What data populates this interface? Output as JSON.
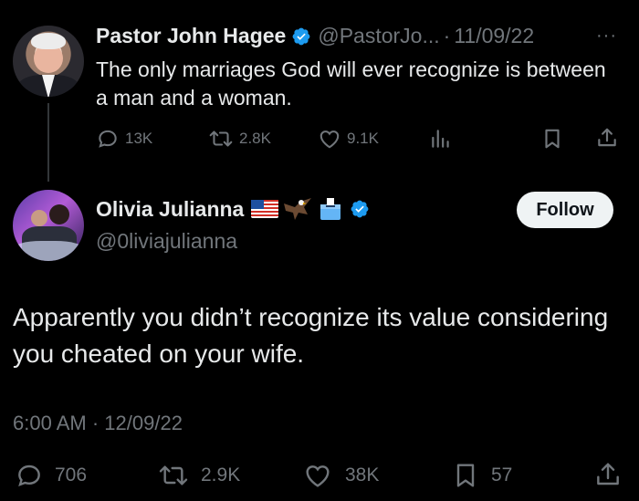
{
  "original_tweet": {
    "author_name": "Pastor John Hagee",
    "handle": "@PastorJo...",
    "separator": "·",
    "date": "11/09/22",
    "more": "···",
    "text": "The only marriages God will ever recognize is between a man and a woman.",
    "actions": {
      "replies": "13K",
      "retweets": "2.8K",
      "likes": "9.1K"
    }
  },
  "reply_tweet": {
    "author_name": "Olivia Julianna",
    "handle": "@0liviajulianna",
    "follow_label": "Follow",
    "text": "Apparently you didn’t recognize its value considering you cheated on your wife.",
    "time": "6:00 AM",
    "separator": "·",
    "date": "12/09/22",
    "actions": {
      "replies": "706",
      "retweets": "2.9K",
      "likes": "38K",
      "bookmarks": "57"
    }
  },
  "colors": {
    "background": "#000000",
    "text": "#e7e9ea",
    "secondary": "#71767b",
    "verified": "#1d9bf0",
    "follow_bg": "#eff3f4"
  },
  "icons": [
    "verified-badge-icon",
    "reply-icon",
    "retweet-icon",
    "like-icon",
    "views-icon",
    "bookmark-icon",
    "share-icon",
    "more-icon",
    "us-flag-emoji",
    "eagle-emoji",
    "ballot-box-emoji"
  ]
}
